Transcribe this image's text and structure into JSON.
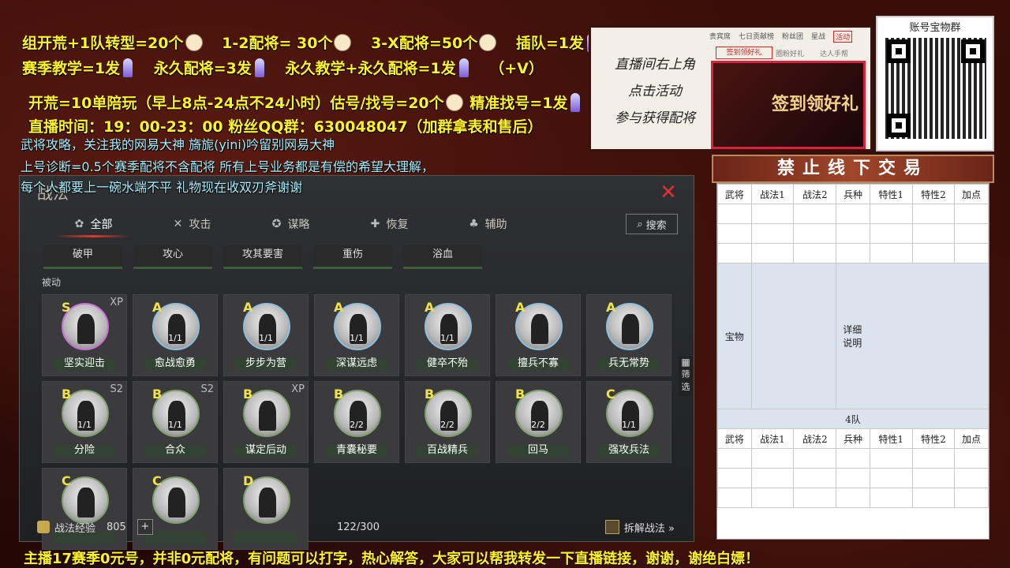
{
  "promo": {
    "line1": [
      "组开荒+1队转型=20个",
      "1-2配将= 30个",
      "3-X配将=50个",
      "插队=1发"
    ],
    "line2": [
      "赛季教学=1发",
      "永久配将=3发",
      "永久教学+永久配将=1发",
      "（+V）"
    ],
    "line3": [
      "开荒=10单陪玩（早上8点-24点不24小时）估号/找号=20个",
      "精准找号=1发"
    ],
    "line4": "直播时间：19：00-23：00   粉丝QQ群：630048047（加群拿表和售后）",
    "line5": "武将攻略，关注我的网易大神 旖旎(yini)吟留别网易大神",
    "line6": "上号诊断=0.5个赛季配将不含配将 所有上号业务都是有偿的希望大理解，",
    "line7": "每个人都要上一碗水端不平 礼物现在收双刃斧谢谢"
  },
  "panel": {
    "title": "战法",
    "tabs": [
      {
        "label": "全部",
        "icon": "all-icon"
      },
      {
        "label": "攻击",
        "icon": "swords-icon"
      },
      {
        "label": "谋略",
        "icon": "scheme-icon"
      },
      {
        "label": "恢复",
        "icon": "heal-icon"
      },
      {
        "label": "辅助",
        "icon": "support-icon"
      }
    ],
    "search_label": "搜索",
    "top_row": [
      "破甲",
      "攻心",
      "攻其要害",
      "重伤",
      "浴血"
    ],
    "section_title": "被动",
    "cards": [
      {
        "grade": "S",
        "tag": "XP",
        "count": "",
        "name": "坚实迎击",
        "ring": "purple"
      },
      {
        "grade": "A",
        "tag": "",
        "count": "1/1",
        "name": "愈战愈勇",
        "ring": "blue"
      },
      {
        "grade": "A",
        "tag": "",
        "count": "1/1",
        "name": "步步为营",
        "ring": "blue"
      },
      {
        "grade": "A",
        "tag": "",
        "count": "1/1",
        "name": "深谋远虑",
        "ring": "blue"
      },
      {
        "grade": "A",
        "tag": "",
        "count": "1/1",
        "name": "健卒不殆",
        "ring": "blue"
      },
      {
        "grade": "A",
        "tag": "",
        "count": "",
        "name": "擅兵不寡",
        "ring": "blue"
      },
      {
        "grade": "A",
        "tag": "",
        "count": "",
        "name": "兵无常势",
        "ring": "blue"
      },
      {
        "grade": "B",
        "tag": "S2",
        "count": "1/1",
        "name": "分险",
        "ring": "green"
      },
      {
        "grade": "B",
        "tag": "S2",
        "count": "1/1",
        "name": "合众",
        "ring": "green"
      },
      {
        "grade": "B",
        "tag": "XP",
        "count": "",
        "name": "谋定后动",
        "ring": "green"
      },
      {
        "grade": "B",
        "tag": "",
        "count": "2/2",
        "name": "青囊秘要",
        "ring": "green"
      },
      {
        "grade": "B",
        "tag": "",
        "count": "2/2",
        "name": "百战精兵",
        "ring": "green"
      },
      {
        "grade": "B",
        "tag": "",
        "count": "2/2",
        "name": "回马",
        "ring": "green"
      },
      {
        "grade": "C",
        "tag": "",
        "count": "1/1",
        "name": "强攻兵法",
        "ring": "green"
      },
      {
        "grade": "C",
        "tag": "",
        "count": "",
        "name": "",
        "ring": "green"
      },
      {
        "grade": "C",
        "tag": "",
        "count": "",
        "name": "",
        "ring": "green"
      },
      {
        "grade": "D",
        "tag": "",
        "count": "",
        "name": "",
        "ring": "green"
      }
    ],
    "filter_label": "筛选",
    "footer": {
      "exp_label": "战法经验",
      "exp_value": "805",
      "plus": "+",
      "progress": "122/300",
      "decompose": "拆解战法 »"
    }
  },
  "ad": {
    "text": [
      "直播间右上角",
      "点击活动",
      "参与获得配将"
    ],
    "nav": [
      "贵宾席",
      "七日贡献榜",
      "粉丝团",
      "星战",
      "活动"
    ],
    "mini_tabs": [
      "签到领好礼",
      "圈粉好礼",
      "达人手帮"
    ],
    "banner": "签到领好礼"
  },
  "qr": {
    "title": "账号宝物群"
  },
  "warning": "禁止线下交易",
  "sheet": {
    "headers": [
      "武将",
      "战法1",
      "战法2",
      "兵种",
      "特性1",
      "特性2",
      "加点"
    ],
    "treasure": "宝物",
    "detail": [
      "详细",
      "说明"
    ],
    "team": "4队"
  },
  "ticker": "主播17赛季0元号，并非0元配将，有问题可以打字，热心解答，大家可以帮我转发一下直播链接，谢谢，谢绝白嫖！"
}
